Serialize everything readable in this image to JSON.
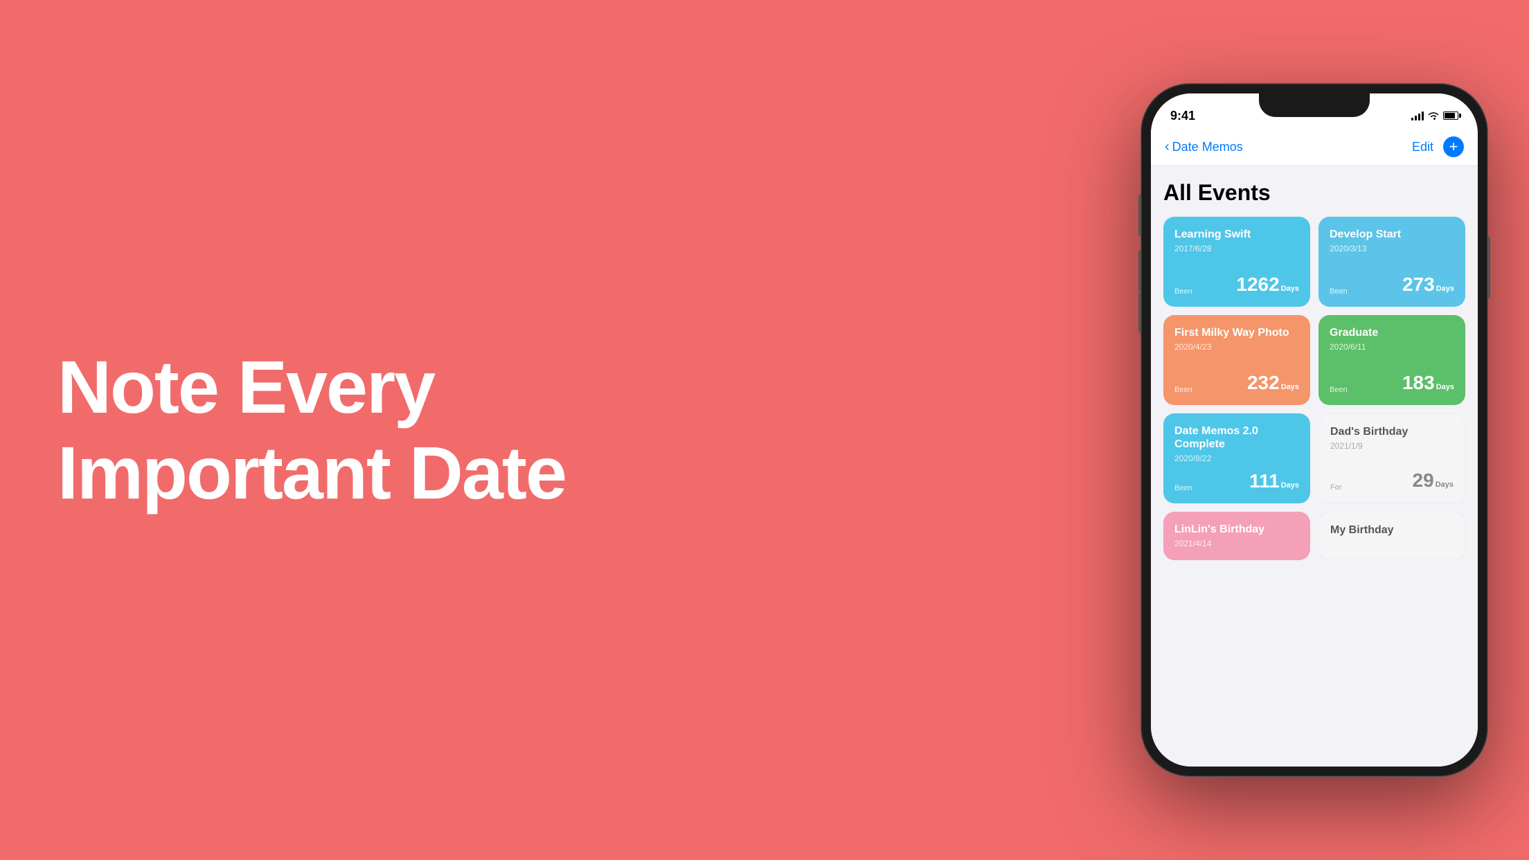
{
  "background_color": "#F16B6B",
  "hero": {
    "line1": "Note Every",
    "line2": "Important Date"
  },
  "phone": {
    "status_bar": {
      "time": "9:41",
      "signal_label": "signal",
      "wifi_label": "wifi",
      "battery_label": "battery"
    },
    "nav": {
      "back_label": "Date Memos",
      "edit_label": "Edit",
      "add_label": "+"
    },
    "page_title": "All Events",
    "cards": [
      {
        "id": "learning-swift",
        "title": "Learning Swift",
        "date": "2017/6/28",
        "label": "Been",
        "days": "1262",
        "color": "blue"
      },
      {
        "id": "develop-start",
        "title": "Develop Start",
        "date": "2020/3/13",
        "label": "Been",
        "days": "273",
        "color": "cyan"
      },
      {
        "id": "first-milky-way",
        "title": "First Milky Way Photo",
        "date": "2020/4/23",
        "label": "Been",
        "days": "232",
        "color": "orange"
      },
      {
        "id": "graduate",
        "title": "Graduate",
        "date": "2020/6/11",
        "label": "Been",
        "days": "183",
        "color": "green"
      },
      {
        "id": "date-memos-complete",
        "title": "Date Memos 2.0 Complete",
        "date": "2020/8/22",
        "label": "Been",
        "days": "111",
        "color": "blue2"
      },
      {
        "id": "dads-birthday",
        "title": "Dad's Birthday",
        "date": "2021/1/9",
        "label": "For",
        "days": "29",
        "color": "light"
      },
      {
        "id": "linlin-birthday",
        "title": "LinLin's Birthday",
        "date": "2021/4/14",
        "label": "",
        "days": "",
        "color": "pink"
      },
      {
        "id": "my-birthday",
        "title": "My Birthday",
        "date": "",
        "label": "",
        "days": "",
        "color": "pink2"
      }
    ]
  }
}
